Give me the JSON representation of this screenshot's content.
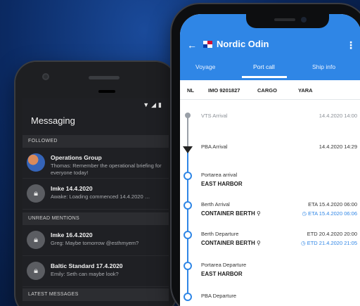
{
  "messaging": {
    "title": "Messaging",
    "status_icons": [
      "wifi-icon",
      "signal-icon"
    ],
    "sections": {
      "followed": "FOLLOWED",
      "unread": "UNREAD MENTIONS",
      "latest": "LATEST MESSAGES"
    },
    "followed": [
      {
        "name": "Operations Group",
        "text": "Thomas: Remember the operational briefing for everyone today!",
        "avatar": "group-avatar"
      },
      {
        "name": "Imke 14.4.2020",
        "text": "Awake: Loading commenced 14.4.2020 …",
        "avatar": "lock-icon"
      }
    ],
    "unread": [
      {
        "name": "Imke 16.4.2020",
        "text": "Greg: Maybe tomorrow @esthmyem?",
        "avatar": "lock-icon"
      },
      {
        "name": "Baltic Standard 17.4.2020",
        "text": "Emily: Seth can maybe look?",
        "avatar": "lock-icon"
      }
    ]
  },
  "ship": {
    "back_icon": "back-arrow-icon",
    "flag": "panama-flag",
    "name": "Nordic Odin",
    "menu_icon": "kebab-menu-icon",
    "tabs": [
      "Voyage",
      "Port call",
      "Ship info"
    ],
    "active_tab": "Port call",
    "ids": [
      "NL",
      "IMO 9201827",
      "CARGO",
      "YARA"
    ],
    "timeline": [
      {
        "label": "VTS Arrival",
        "right": "14.4.2020 14:00",
        "state": "past"
      },
      {
        "label": "PBA Arrival",
        "right": "14.4.2020 14:29",
        "state": "current"
      },
      {
        "label": "Portarea arrival",
        "place": "EAST HARBOR",
        "state": "future"
      },
      {
        "label": "Berth Arrival",
        "place": "CONTAINER BERTH",
        "right": "ETA 15.4.2020 06:00",
        "right2": "ETA 15.4.2020 06:06",
        "state": "future"
      },
      {
        "label": "Berth Departure",
        "place": "CONTAINER BERTH",
        "right": "ETD 20.4.2020 20:00",
        "right2": "ETD 21.4.2020 21:05",
        "state": "future"
      },
      {
        "label": "Portarea Departure",
        "place": "EAST HARBOR",
        "state": "future"
      },
      {
        "label": "PBA Departure",
        "state": "future"
      }
    ],
    "colors": {
      "accent": "#2f86e6",
      "header": "#2f86e6"
    }
  }
}
